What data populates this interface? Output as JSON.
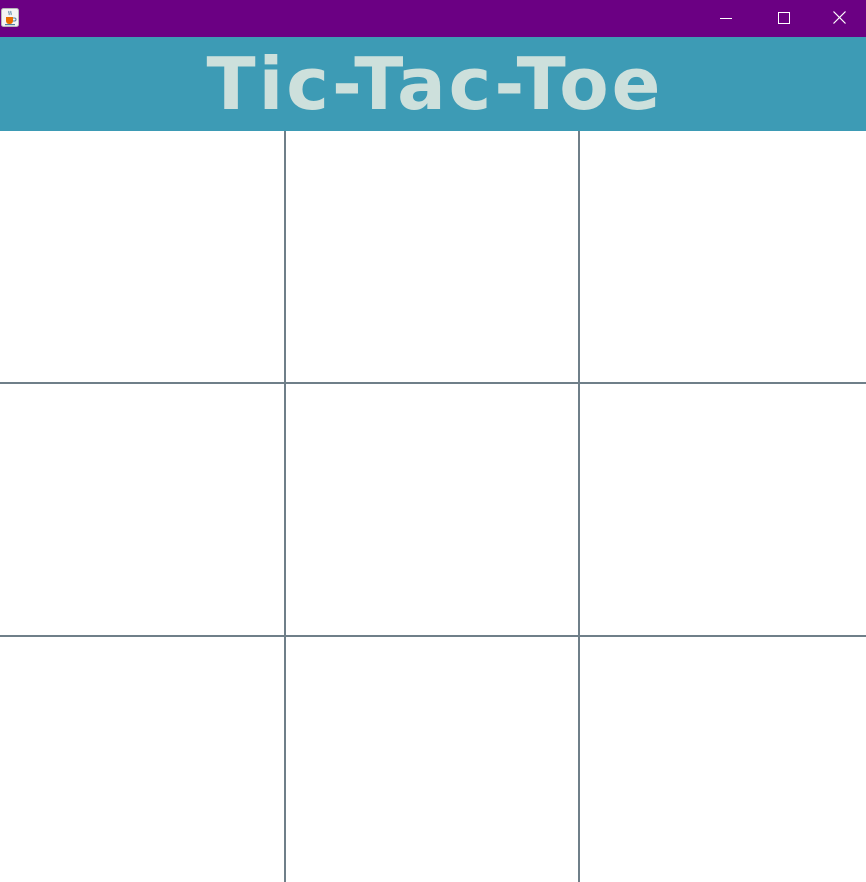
{
  "window": {
    "accent_color": "#6b0083",
    "app_icon": "java-cup-icon",
    "controls": {
      "minimize_icon": "minimize-icon",
      "maximize_icon": "maximize-icon",
      "close_icon": "close-icon"
    }
  },
  "header": {
    "title": "Tic-Tac-Toe",
    "background_color": "#3d9bb5",
    "text_color": "#cde0dc"
  },
  "board": {
    "grid_line_color": "#6f7f89",
    "cells": [
      {
        "row": 1,
        "col": 1,
        "mark": ""
      },
      {
        "row": 1,
        "col": 2,
        "mark": ""
      },
      {
        "row": 1,
        "col": 3,
        "mark": ""
      },
      {
        "row": 2,
        "col": 1,
        "mark": ""
      },
      {
        "row": 2,
        "col": 2,
        "mark": ""
      },
      {
        "row": 2,
        "col": 3,
        "mark": ""
      },
      {
        "row": 3,
        "col": 1,
        "mark": ""
      },
      {
        "row": 3,
        "col": 2,
        "mark": ""
      },
      {
        "row": 3,
        "col": 3,
        "mark": ""
      }
    ]
  }
}
